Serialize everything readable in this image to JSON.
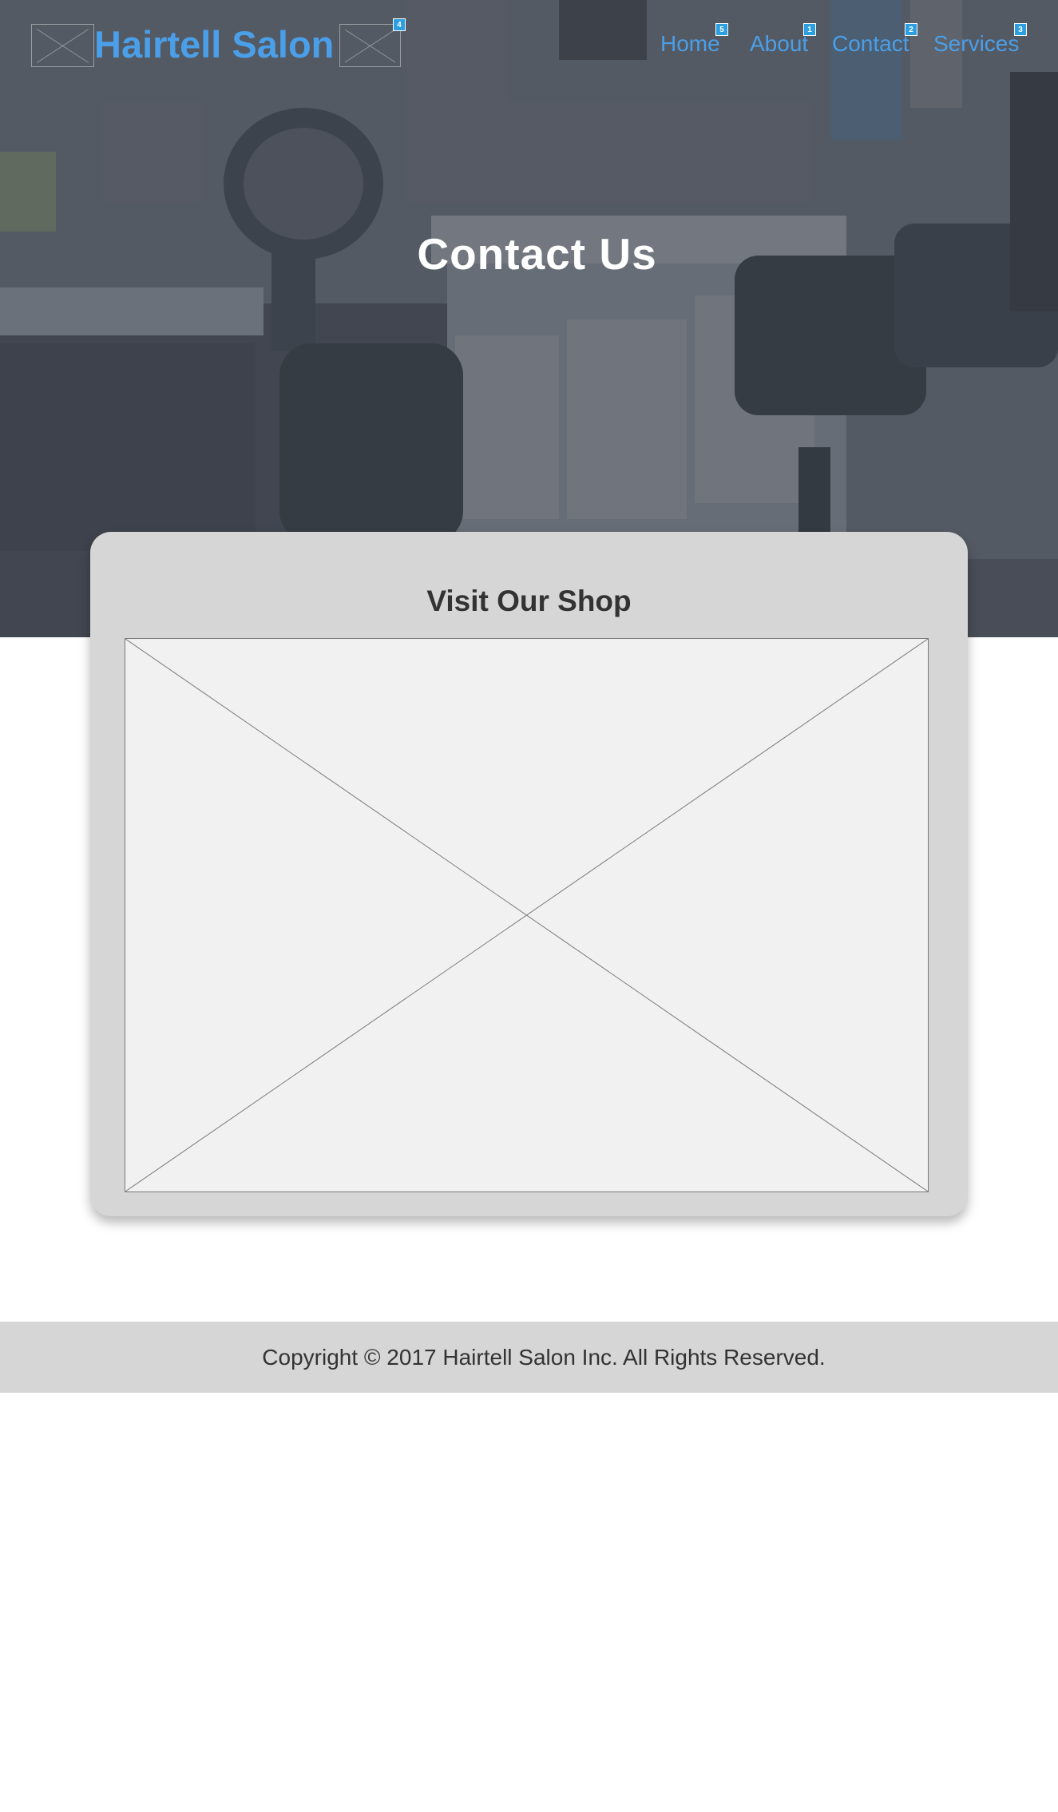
{
  "header": {
    "brand": "Hairtell Salon",
    "brand_badge": "4"
  },
  "nav": {
    "items": [
      {
        "label": "Home",
        "badge": "5"
      },
      {
        "label": "About",
        "badge": "1"
      },
      {
        "label": "Contact",
        "badge": "2"
      },
      {
        "label": "Services",
        "badge": "3"
      }
    ]
  },
  "hero": {
    "title": "Contact Us"
  },
  "visit": {
    "title": "Visit Our Shop"
  },
  "footer": {
    "copyright": "Copyright © 2017 Hairtell Salon Inc. All Rights Reserved."
  },
  "colors": {
    "accent": "#4a9fe8",
    "badge": "#2b9fe0",
    "card": "#d6d6d6",
    "text": "#333333"
  }
}
